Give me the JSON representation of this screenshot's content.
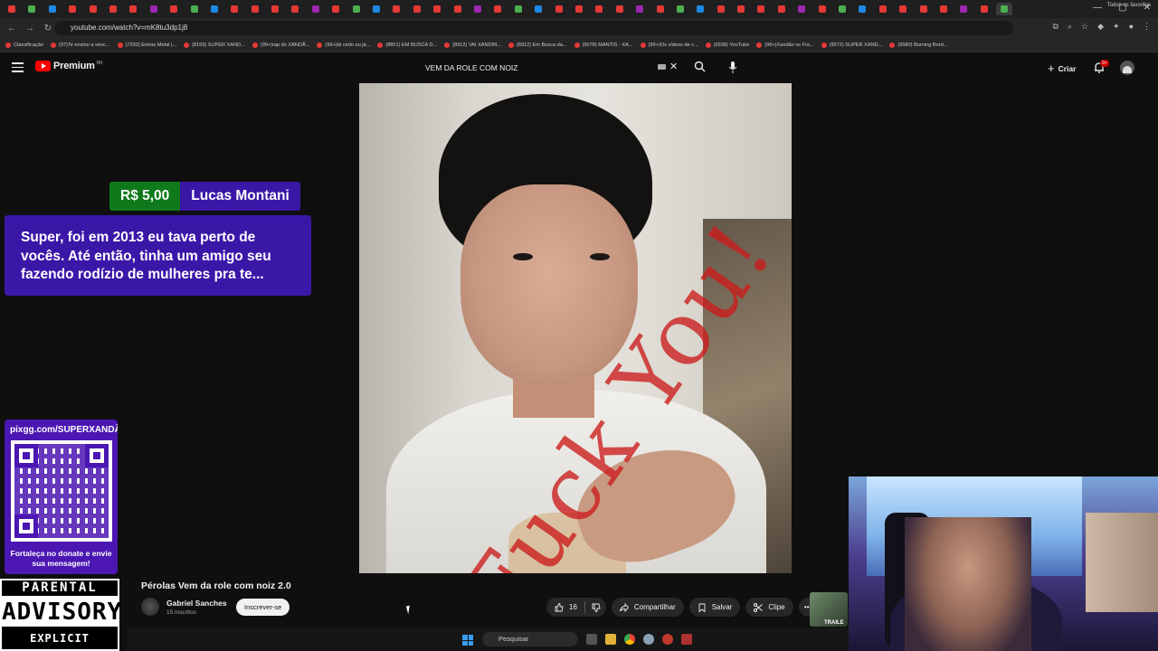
{
  "browser": {
    "url": "youtube.com/watch?v=mK8tu3dp1j8",
    "bookmarks": [
      "Classificação",
      "(97)Te ensino a venc...",
      "(7292) Enéas Metal |...",
      "(8159) SUPER XAND...",
      "(99+)rap do XANDÃ...",
      "(99+)tá cedo ou já...",
      "(8851) EM BUSCA D...",
      "(8912) VAI XANDIN...",
      "(8912) Em Busca da...",
      "(9078) MANTIS - XA...",
      "(99+)Os vídeos de c...",
      "(9338) YouTube",
      "(99+)Xandão vs Fra...",
      "(9572) SUPER XAND...",
      "(9580) Burning Bord..."
    ],
    "bookmarks_right": "Todos os favoritos"
  },
  "youtube": {
    "logo_text": "Premium",
    "logo_region": "BR",
    "search_query": "VEM DA ROLE COM NOIZ",
    "create_label": "Criar",
    "notif_badge": "9+",
    "video_watermark": "Fuck You!",
    "video_title": "Pérolas Vem da role com noiz 2.0",
    "channel_name": "Gabriel Sanches",
    "channel_subs": "15 inscritos",
    "subscribe_label": "Inscrever-se",
    "likes": "16",
    "share_label": "Compartilhar",
    "save_label": "Salvar",
    "clip_label": "Clipe",
    "next_thumb_label": "TRAILE"
  },
  "overlay": {
    "superchat_amount": "R$ 5,00",
    "superchat_name": "Lucas Montani",
    "superchat_text": "Super, foi em 2013 eu tava perto de vocês. Até então, tinha um amigo seu fazendo rodízio de mulheres pra te...",
    "pix_url": "pixgg.com/SUPERXANDÃ",
    "pix_caption": "Fortaleça no donate e envie sua mensagem!",
    "advisory_line1": "PARENTAL",
    "advisory_line2": "ADVISORY",
    "advisory_line3": "EXPLICIT CONTENT"
  },
  "taskbar": {
    "search_placeholder": "Pesquisar"
  },
  "colors": {
    "superchat_green": "#0f7a1b",
    "superchat_purple": "#3b17a8",
    "youtube_red": "#ff0000"
  }
}
